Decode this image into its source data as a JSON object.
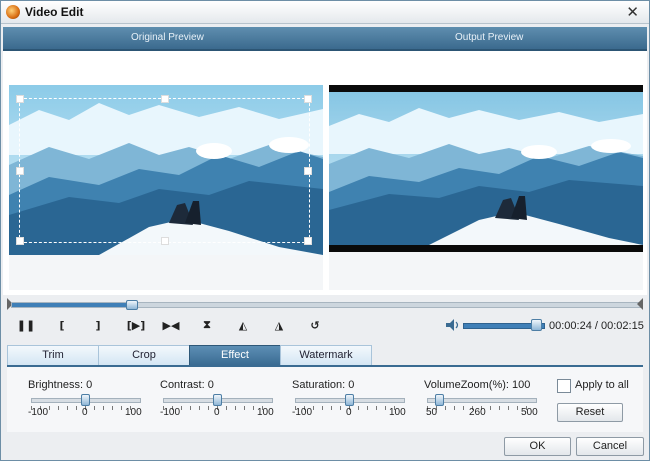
{
  "window": {
    "title": "Video Edit"
  },
  "preview": {
    "original_label": "Original Preview",
    "output_label": "Output Preview"
  },
  "timeline": {
    "progress": 0.19
  },
  "controls": {
    "pause_glyph": "❚❚",
    "mark_in_glyph": "[",
    "mark_out_glyph": "]",
    "play_segment_glyph": "[▶]",
    "next_frame_glyph": "▶◀",
    "fit_glyph": "⧗",
    "rotate_left_glyph": "◭",
    "rotate_right_glyph": "◮",
    "undo_glyph": "↺"
  },
  "volume": {
    "level": 0.9
  },
  "time": {
    "current": "00:00:24",
    "separator": " / ",
    "total": "00:02:15"
  },
  "tabs": [
    {
      "label": "Trim"
    },
    {
      "label": "Crop"
    },
    {
      "label": "Effect"
    },
    {
      "label": "Watermark"
    }
  ],
  "active_tab": "Effect",
  "effect": {
    "brightness": {
      "label": "Brightness:",
      "value": "0",
      "min": "-100",
      "mid": "0",
      "max": "100",
      "level": 0.5
    },
    "contrast": {
      "label": "Contrast:",
      "value": "0",
      "min": "-100",
      "mid": "0",
      "max": "100",
      "level": 0.5
    },
    "saturation": {
      "label": "Saturation:",
      "value": "0",
      "min": "-100",
      "mid": "0",
      "max": "100",
      "level": 0.5
    },
    "volumezoom": {
      "label": "VolumeZoom(%):",
      "value": "100",
      "min": "50",
      "mid": "260",
      "max": "500",
      "level": 0.11
    },
    "apply_to_all": "Apply to all",
    "reset": "Reset"
  },
  "buttons": {
    "ok": "OK",
    "cancel": "Cancel"
  },
  "colors": {
    "accent": "#3a6b92",
    "header": "#4a7aa0",
    "sky": "#bfe3f5",
    "mountain": "#2f6f9e"
  }
}
